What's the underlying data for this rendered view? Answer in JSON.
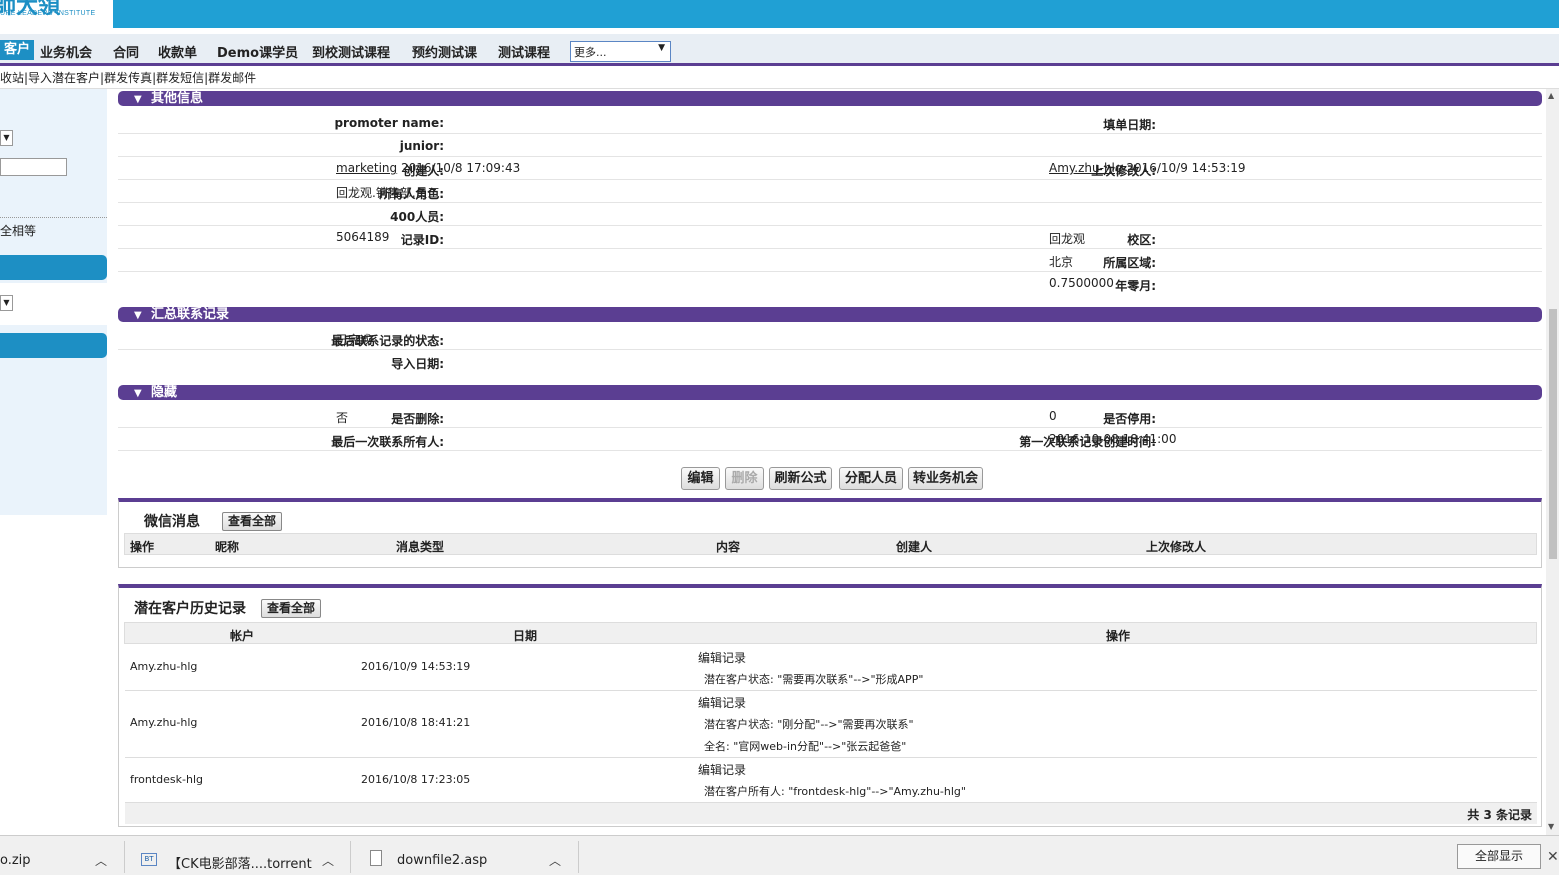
{
  "app": {
    "logo_big": "師大領",
    "logo_small": "URE LEADERS' INSTITUTE"
  },
  "nav": {
    "items": [
      "客户",
      "业务机会",
      "合同",
      "收款单",
      "Demo课学员",
      "到校测试课程",
      "预约测试课",
      "测试课程"
    ],
    "more_select": "更多..."
  },
  "toolbar": {
    "text": "收站|导入潜在客户|群发传真|群发短信|群发邮件"
  },
  "left_panel": {
    "text_equal": "全相等"
  },
  "sections": {
    "other_info": "其他信息",
    "contact_summary": "汇总联系记录",
    "hidden": "隐藏"
  },
  "other_info": {
    "promoter_name_label": "promoter name:",
    "promoter_name_value": "",
    "fill_date_label": "填单日期:",
    "fill_date_value": "",
    "junior_label": "junior:",
    "junior_value": "",
    "creator_label": "创建人:",
    "creator_user": "marketing",
    "creator_time": "2016/10/8 17:09:43",
    "last_modified_label": "上次修改人:",
    "last_modified_user": "Amy.zhu-hlg",
    "last_modified_time": "2016/10/9 14:53:19",
    "owner_role_label": "所有人角色:",
    "owner_role_value": "回龙观.销售部.员工",
    "staff400_label": "400人员:",
    "staff400_value": "",
    "record_id_label": "记录ID:",
    "record_id_value": "5064189",
    "campus_label": "校区:",
    "campus_value": "回龙观",
    "region_label": "所属区域:",
    "region_value": "北京",
    "year_month_label": "年零月:",
    "year_month_value": "0.7500000"
  },
  "contact_summary": {
    "last_status_label": "最后联系记录的状态:",
    "last_status_value": "已完成",
    "import_date_label": "导入日期:",
    "import_date_value": ""
  },
  "hidden": {
    "deleted_label": "是否删除:",
    "deleted_value": "否",
    "disabled_label": "是否停用:",
    "disabled_value": "0",
    "last_contact_owner_label": "最后一次联系所有人:",
    "last_contact_owner_value": "",
    "first_contact_time_label": "第一次联系记录创建时间:",
    "first_contact_time_value": "2016-10-08 18:41:00"
  },
  "actions": {
    "edit": "编辑",
    "delete": "删除",
    "refresh": "刷新公式",
    "assign": "分配人员",
    "convert": "转业务机会"
  },
  "wechat": {
    "title": "微信消息",
    "view_all": "查看全部",
    "columns": [
      "操作",
      "昵称",
      "消息类型",
      "内容",
      "创建人",
      "上次修改人"
    ]
  },
  "history": {
    "title": "潜在客户历史记录",
    "view_all": "查看全部",
    "columns": [
      "帐户",
      "日期",
      "操作"
    ],
    "rows": [
      {
        "account": "Amy.zhu-hlg",
        "date": "2016/10/9 14:53:19",
        "op_title": "编辑记录",
        "op_lines": [
          "潜在客户状态: \"需要再次联系\"-->\"形成APP\""
        ]
      },
      {
        "account": "Amy.zhu-hlg",
        "date": "2016/10/8 18:41:21",
        "op_title": "编辑记录",
        "op_lines": [
          "潜在客户状态: \"刚分配\"-->\"需要再次联系\"",
          "全名: \"官网web-in分配\"-->\"张云起爸爸\""
        ]
      },
      {
        "account": "frontdesk-hlg",
        "date": "2016/10/8 17:23:05",
        "op_title": "编辑记录",
        "op_lines": [
          "潜在客户所有人: \"frontdesk-hlg\"-->\"Amy.zhu-hlg\""
        ]
      }
    ],
    "total": "共 3 条记录"
  },
  "downloads": {
    "items": [
      "o.zip",
      "【CK电影部落....torrent",
      "downfile2.asp"
    ],
    "show_all": "全部显示"
  },
  "colors": {
    "header_blue": "#20a0d4",
    "section_purple": "#5b3e92"
  }
}
